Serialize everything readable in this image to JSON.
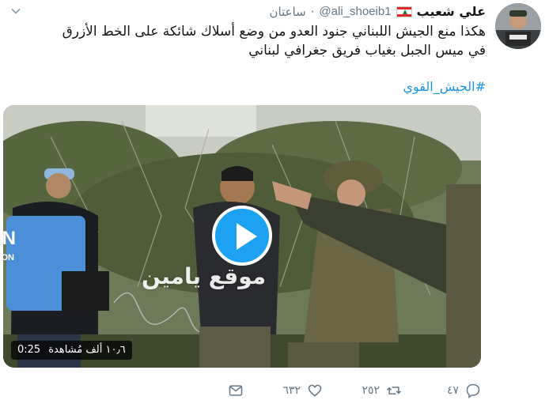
{
  "tweet": {
    "display_name": "علي شعيب",
    "handle": "@ali_shoeib1",
    "separator": "·",
    "time": "ساعتان",
    "text": "هكذا منع الجيش اللبناني جنود العدو من وضع أسلاك شائكة على الخط الأزرق في ميس الجبل بغياب فريق جغرافي لبناني",
    "hashtag": "#الجيش_القوي",
    "colors": {
      "accent": "#1da1f2",
      "link": "#1b95e0",
      "muted": "#657786",
      "text": "#14171a"
    },
    "icons": [
      "chevron-down-icon",
      "lebanon-flag-icon",
      "avatar"
    ]
  },
  "media": {
    "watermark": "موقع يامين",
    "duration": "0:25",
    "views": "١٠٫٦ ألف مُشاهدة",
    "vest_text": "UN",
    "vest_subtext": "UNIFIL LIAISON",
    "icons": [
      "play-icon"
    ]
  },
  "actions": {
    "reply_count": "٤٧",
    "retweet_count": "٢٥٢",
    "like_count": "٦٣٢",
    "icons": [
      "reply-icon",
      "retweet-icon",
      "like-icon",
      "dm-icon"
    ]
  }
}
